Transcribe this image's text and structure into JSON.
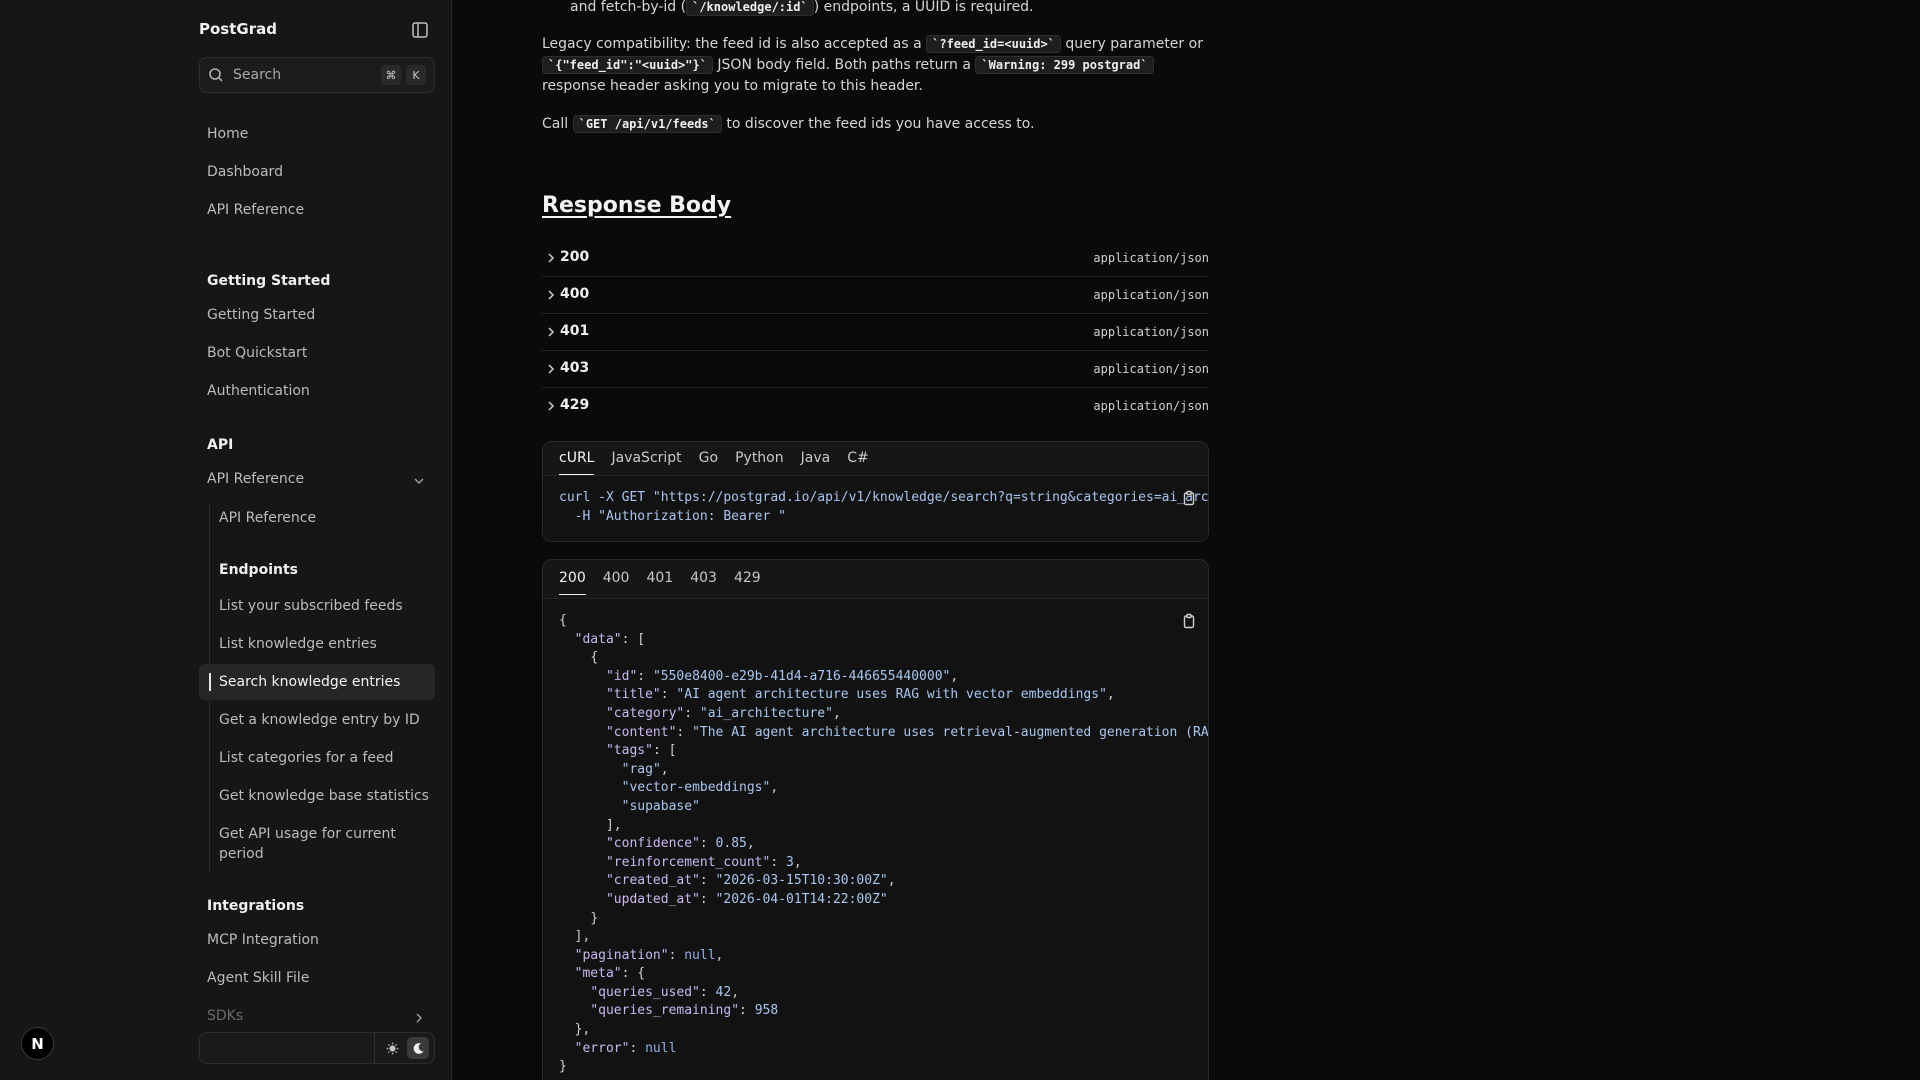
{
  "sidebar": {
    "brand": "PostGrad",
    "search_placeholder": "Search",
    "shortcut": [
      "⌘",
      "K"
    ],
    "top_items": [
      "Home",
      "Dashboard",
      "API Reference"
    ],
    "sections": {
      "getting_started": {
        "title": "Getting Started",
        "items": [
          "Getting Started",
          "Bot Quickstart",
          "Authentication"
        ]
      },
      "api": {
        "title": "API",
        "group_label": "API Reference",
        "sub_items_top": [
          "API Reference"
        ],
        "endpoints_title": "Endpoints",
        "endpoints": [
          "List your subscribed feeds",
          "List knowledge entries",
          "Search knowledge entries",
          "Get a knowledge entry by ID",
          "List categories for a feed",
          "Get knowledge base statistics",
          "Get API usage for current period"
        ],
        "active_endpoint": "Search knowledge entries"
      },
      "integrations": {
        "title": "Integrations",
        "items": [
          "MCP Integration",
          "Agent Skill File",
          "SDKs"
        ]
      }
    },
    "badge": "N"
  },
  "content": {
    "para1_prefix": "and fetch-by-id (",
    "para1_code": "`/knowledge/:id`",
    "para1_suffix": ") endpoints, a UUID is required.",
    "para2_text1": "Legacy compatibility: the feed id is also accepted as a ",
    "para2_code1": "`?feed_id=<uuid>`",
    "para2_text2": " query parameter or",
    "para2_code2": "`{\"feed_id\":\"<uuid>\"}`",
    "para2_text3": " JSON body field. Both paths return a ",
    "para2_code3": "`Warning: 299 postgrad`",
    "para2_text4": "response header asking you to migrate to this header.",
    "para3_prefix": "Call ",
    "para3_code": "`GET /api/v1/feeds`",
    "para3_suffix": " to discover the feed ids you have access to.",
    "response_heading": "Response Body",
    "responses": [
      {
        "code": "200",
        "mime": "application/json"
      },
      {
        "code": "400",
        "mime": "application/json"
      },
      {
        "code": "401",
        "mime": "application/json"
      },
      {
        "code": "403",
        "mime": "application/json"
      },
      {
        "code": "429",
        "mime": "application/json"
      }
    ],
    "request_tabs": [
      "cURL",
      "JavaScript",
      "Go",
      "Python",
      "Java",
      "C#"
    ],
    "active_request_tab": "cURL",
    "curl_line1": "curl -X GET \"https://postgrad.io/api/v1/knowledge/search?q=string&categories=ai_arch",
    "curl_line2": "  -H \"Authorization: Bearer \"",
    "response_tabs": [
      "200",
      "400",
      "401",
      "403",
      "429"
    ],
    "active_response_tab": "200",
    "response_example": {
      "id": "550e8400-e29b-41d4-a716-446655440000",
      "title": "AI agent architecture uses RAG with vector embeddings",
      "category": "ai_architecture",
      "content": "The AI agent architecture uses retrieval-augmented generation (RAG",
      "tags": [
        "rag",
        "vector-embeddings",
        "supabase"
      ],
      "confidence": "0.85",
      "reinforcement_count": "3",
      "created_at": "2026-03-15T10:30:00Z",
      "updated_at": "2026-04-01T14:22:00Z",
      "pagination": "null",
      "queries_used": "42",
      "queries_remaining": "958",
      "error": "null"
    }
  },
  "colors": {
    "background": "#0a0a0a",
    "sidebar": "#161616",
    "json_key": "#c9b8f0",
    "json_string": "#a8c7f0"
  }
}
